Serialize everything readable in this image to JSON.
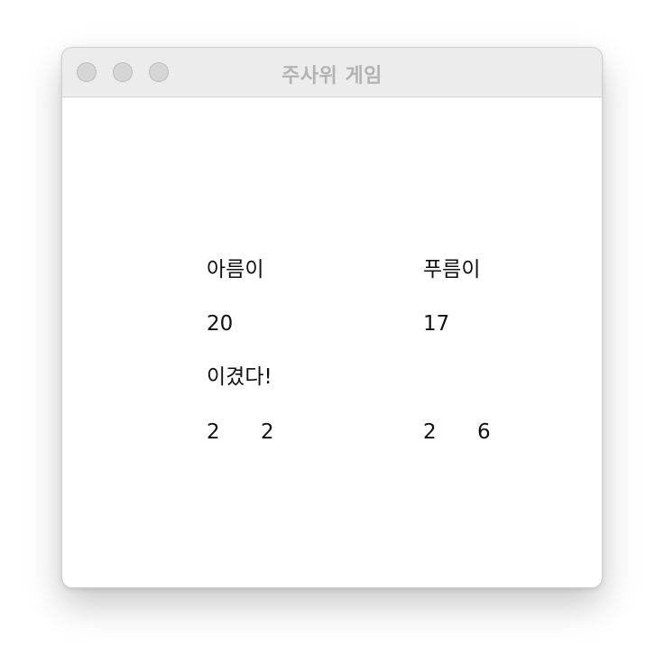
{
  "window": {
    "title": "주사위 게임"
  },
  "players": [
    {
      "name": "아름이",
      "score": "20",
      "result": "이겼다!",
      "dice": [
        "2",
        "2"
      ]
    },
    {
      "name": "푸름이",
      "score": "17",
      "result": "",
      "dice": [
        "2",
        "6"
      ]
    }
  ]
}
